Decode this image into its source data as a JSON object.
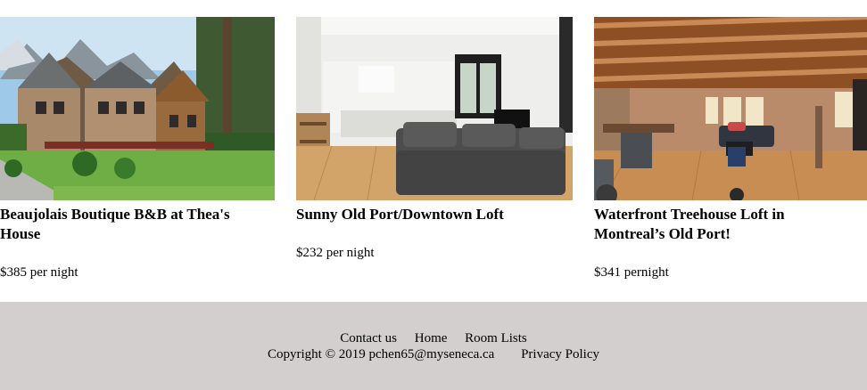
{
  "listings": [
    {
      "title": "Beaujolais Boutique B&B at Thea's House",
      "price": "$385 per night",
      "image_alt": "Beaujolais Boutique B&B exterior"
    },
    {
      "title": "Sunny Old Port/Downtown Loft",
      "price": "$232 per night",
      "image_alt": "Sunny loft living room"
    },
    {
      "title": "Waterfront Treehouse Loft in Montreal’s Old Port!",
      "price": "$341 pernight",
      "image_alt": "Treehouse loft with wooden beams"
    }
  ],
  "footer": {
    "links": [
      "Contact us",
      "Home",
      "Room Lists"
    ],
    "copyright": "Copyright © 2019 pchen65@myseneca.ca",
    "privacy": "Privacy Policy",
    "background": "#d3cfcf"
  }
}
